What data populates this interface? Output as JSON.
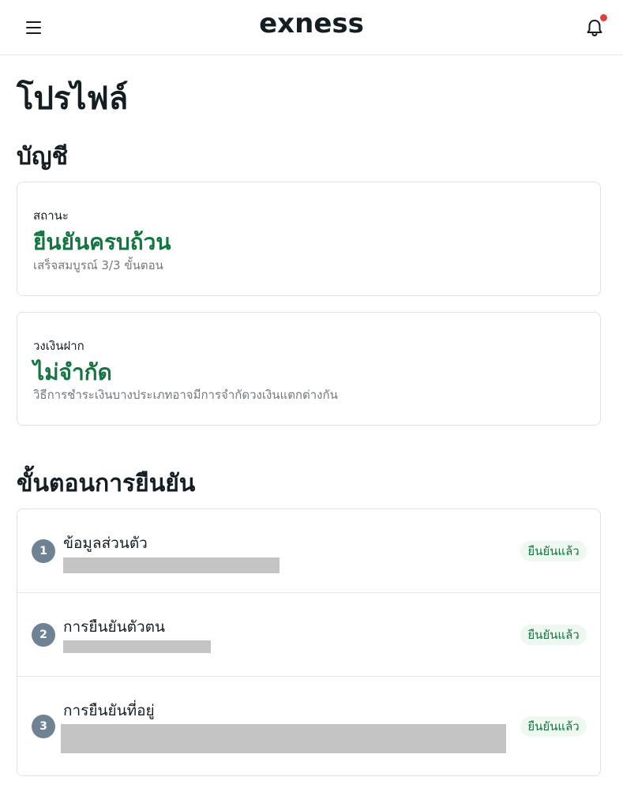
{
  "header": {
    "logo_text": "exness",
    "menu_icon": "hamburger-menu-icon",
    "notification_icon": "bell-icon",
    "notification_dot_color": "#e0403d"
  },
  "page": {
    "title": "โปรไฟล์"
  },
  "account": {
    "section_title": "บัญชี",
    "status": {
      "label": "สถานะ",
      "value": "ยืนยันครบถ้วน",
      "sub": "เสร็จสมบูรณ์ 3/3 ขั้นตอน"
    },
    "deposit_limit": {
      "label": "วงเงินฝาก",
      "value": "ไม่จำกัด",
      "sub": "วิธีการชำระเงินบางประเภทอาจมีการจำกัดวงเงินแตกต่างกัน"
    }
  },
  "verification": {
    "section_title": "ขั้นตอนการยืนยัน",
    "steps": [
      {
        "number": "1",
        "title": "ข้อมูลส่วนตัว",
        "status": "ยืนยันแล้ว"
      },
      {
        "number": "2",
        "title": "การยืนยันตัวตน",
        "status": "ยืนยันแล้ว"
      },
      {
        "number": "3",
        "title": "การยืนยันที่อยู่",
        "status": "ยืนยันแล้ว"
      }
    ]
  },
  "colors": {
    "verified_green": "#13753f",
    "step_circle": "#6e8294",
    "badge_bg": "#eef8f1",
    "redaction": "#c4c4c4"
  }
}
